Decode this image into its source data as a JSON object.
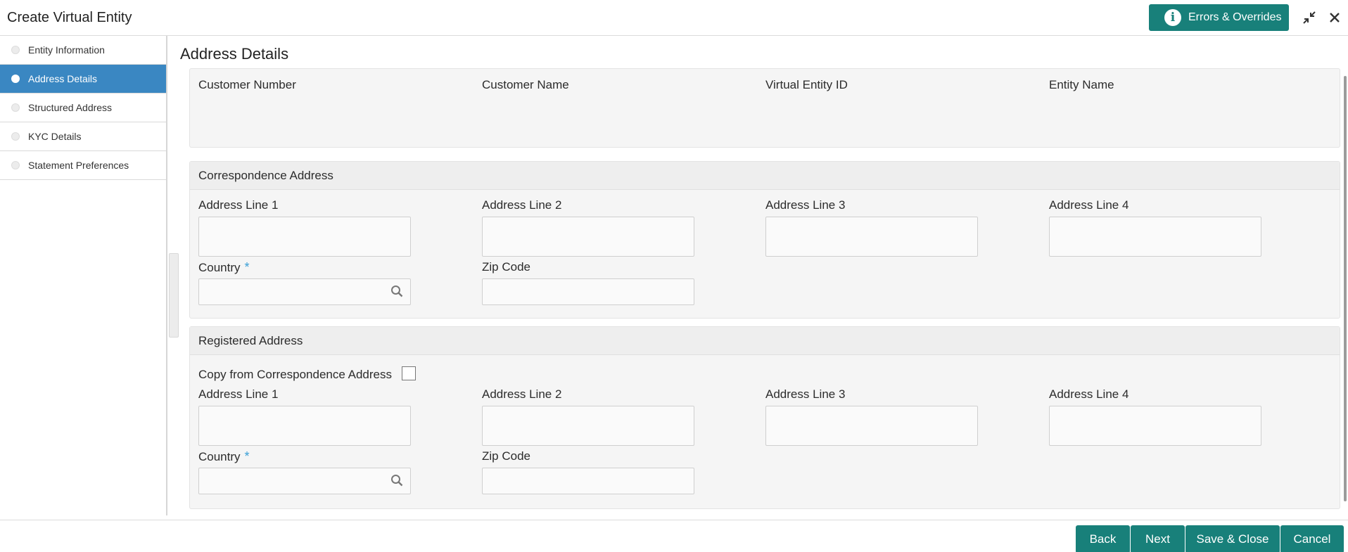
{
  "header": {
    "title": "Create Virtual Entity",
    "errors_button": "Errors & Overrides",
    "icons": [
      "info-icon",
      "shrink-icon",
      "close-icon"
    ]
  },
  "sidebar": {
    "items": [
      {
        "label": "Entity Information",
        "active": false
      },
      {
        "label": "Address Details",
        "active": true
      },
      {
        "label": "Structured Address",
        "active": false
      },
      {
        "label": "KYC Details",
        "active": false
      },
      {
        "label": "Statement Preferences",
        "active": false
      }
    ]
  },
  "main": {
    "section_title": "Address Details",
    "summary": {
      "customer_number_label": "Customer Number",
      "customer_name_label": "Customer Name",
      "virtual_entity_id_label": "Virtual Entity ID",
      "entity_name_label": "Entity Name"
    },
    "correspondence": {
      "header": "Correspondence Address",
      "address_line_1": "Address Line 1",
      "address_line_2": "Address Line 2",
      "address_line_3": "Address Line 3",
      "address_line_4": "Address Line 4",
      "country": "Country",
      "required_mark": "*",
      "zip_code": "Zip Code"
    },
    "registered": {
      "header": "Registered Address",
      "copy_label": "Copy from Correspondence Address",
      "copy_checked": false,
      "address_line_1": "Address Line 1",
      "address_line_2": "Address Line 2",
      "address_line_3": "Address Line 3",
      "address_line_4": "Address Line 4",
      "country": "Country",
      "required_mark": "*",
      "zip_code": "Zip Code"
    }
  },
  "footer": {
    "back": "Back",
    "next": "Next",
    "save_close": "Save & Close",
    "cancel": "Cancel"
  },
  "colors": {
    "primary_button": "#18807a",
    "active_nav": "#3a87c2",
    "required": "#3a9fd6"
  }
}
